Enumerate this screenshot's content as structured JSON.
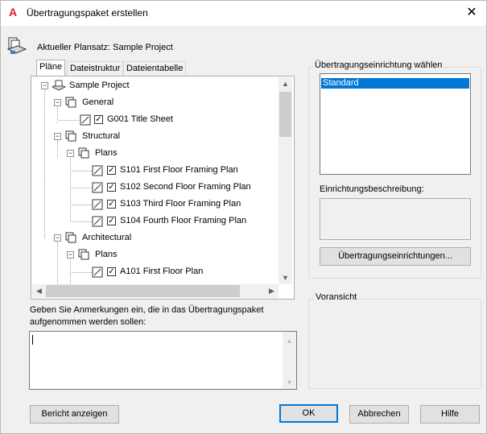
{
  "window": {
    "title": "Übertragungspaket erstellen",
    "close_glyph": "✕",
    "app_icon_letter": "A"
  },
  "current_sheetset": "Aktueller Plansatz: Sample Project",
  "tabs": [
    {
      "label": "Pläne"
    },
    {
      "label": "Dateistruktur"
    },
    {
      "label": "Dateientabelle"
    }
  ],
  "tree": {
    "root": "Sample Project",
    "general": "General",
    "g001": "G001 Title Sheet",
    "structural": "Structural",
    "plans1": "Plans",
    "s101": "S101 First Floor Framing Plan",
    "s102": "S102 Second Floor Framing Plan",
    "s103": "S103 Third Floor Framing Plan",
    "s104": "S104 Fourth Floor Framing Plan",
    "architectural": "Architectural",
    "plans2": "Plans",
    "a101": "A101 First Floor Plan"
  },
  "notes_label_1": "Geben Sie Anmerkungen ein, die in das Übertragungspaket",
  "notes_label_2": "aufgenommen werden sollen:",
  "notes_value": "",
  "setup": {
    "group_label": "Übertragungseinrichtung wählen",
    "selected": "Standard",
    "description_label": "Einrichtungsbeschreibung:",
    "description_value": "",
    "button": "Übertragungseinrichtungen..."
  },
  "preview_label": "Voransicht",
  "buttons": {
    "report": "Bericht anzeigen",
    "ok": "OK",
    "cancel": "Abbrechen",
    "help": "Hilfe"
  },
  "checkbox_glyph": "✓",
  "expander_glyph": "−"
}
